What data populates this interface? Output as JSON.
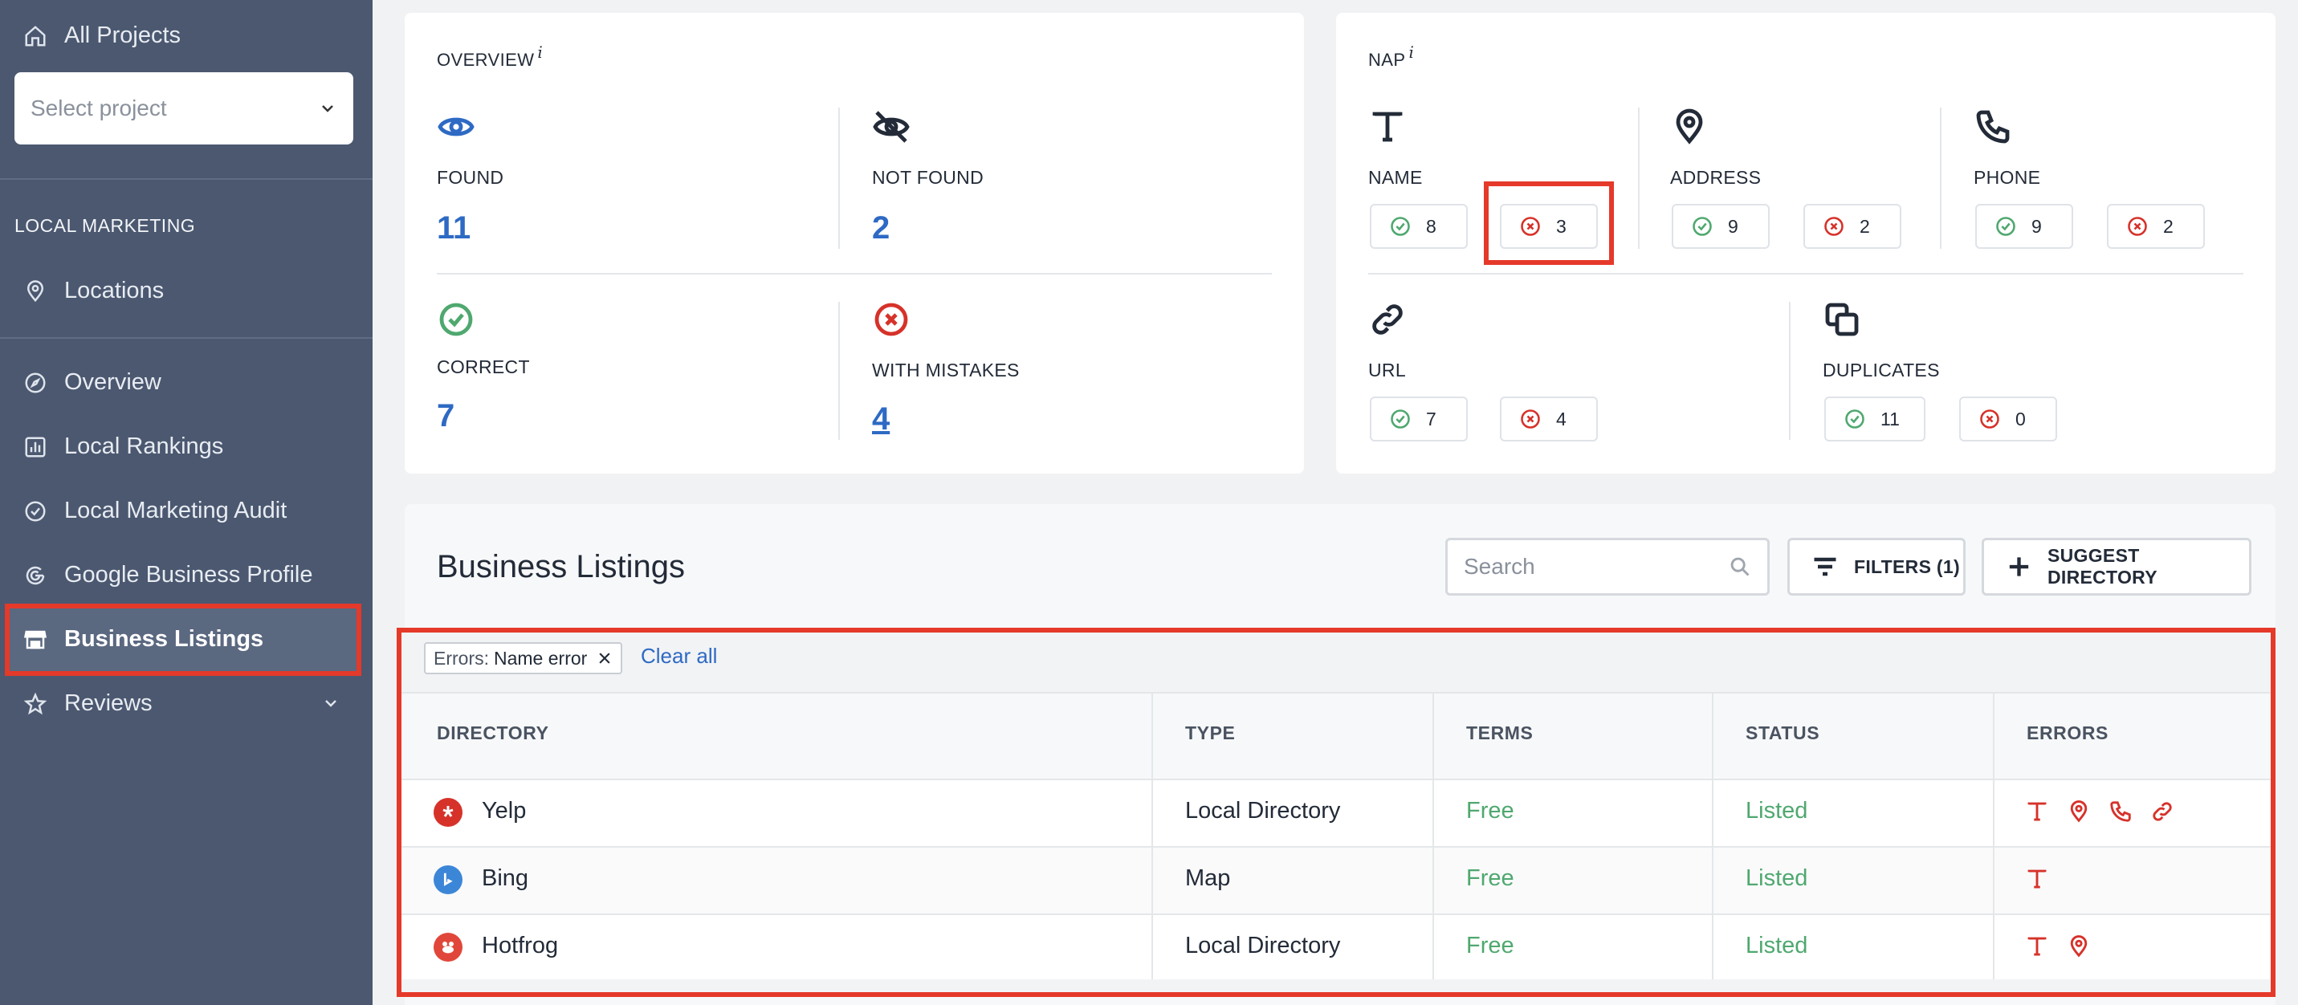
{
  "sidebar": {
    "all_projects": "All Projects",
    "select_placeholder": "Select project",
    "section": "LOCAL MARKETING",
    "items": {
      "locations": "Locations",
      "overview": "Overview",
      "local_rankings": "Local Rankings",
      "audit": "Local Marketing Audit",
      "gbp": "Google Business Profile",
      "business_listings": "Business Listings",
      "reviews": "Reviews"
    }
  },
  "overview": {
    "title": "OVERVIEW",
    "info": "i",
    "found_label": "FOUND",
    "found_value": "11",
    "not_found_label": "NOT FOUND",
    "not_found_value": "2",
    "correct_label": "CORRECT",
    "correct_value": "7",
    "mistakes_label": "WITH MISTAKES",
    "mistakes_value": "4"
  },
  "nap": {
    "title": "NAP",
    "info": "i",
    "name": {
      "label": "NAME",
      "ok": "8",
      "err": "3"
    },
    "address": {
      "label": "ADDRESS",
      "ok": "9",
      "err": "2"
    },
    "phone": {
      "label": "PHONE",
      "ok": "9",
      "err": "2"
    },
    "url": {
      "label": "URL",
      "ok": "7",
      "err": "4"
    },
    "duplicates": {
      "label": "DUPLICATES",
      "ok": "11",
      "err": "0"
    }
  },
  "listings": {
    "title": "Business Listings",
    "search_placeholder": "Search",
    "filters_label": "FILTERS (1)",
    "suggest_label": "SUGGEST DIRECTORY",
    "chip_key": "Errors:",
    "chip_value": "Name error",
    "clear_all": "Clear all",
    "columns": {
      "directory": "DIRECTORY",
      "type": "TYPE",
      "terms": "TERMS",
      "status": "STATUS",
      "errors": "ERRORS"
    },
    "rows": [
      {
        "directory": "Yelp",
        "type": "Local Directory",
        "terms": "Free",
        "status": "Listed"
      },
      {
        "directory": "Bing",
        "type": "Map",
        "terms": "Free",
        "status": "Listed"
      },
      {
        "directory": "Hotfrog",
        "type": "Local Directory",
        "terms": "Free",
        "status": "Listed"
      }
    ]
  },
  "colors": {
    "sidebar": "#4b5870",
    "accent_blue": "#2e6ac4",
    "success": "#4fa86f",
    "error": "#d6322a",
    "highlight": "#e5392a"
  }
}
